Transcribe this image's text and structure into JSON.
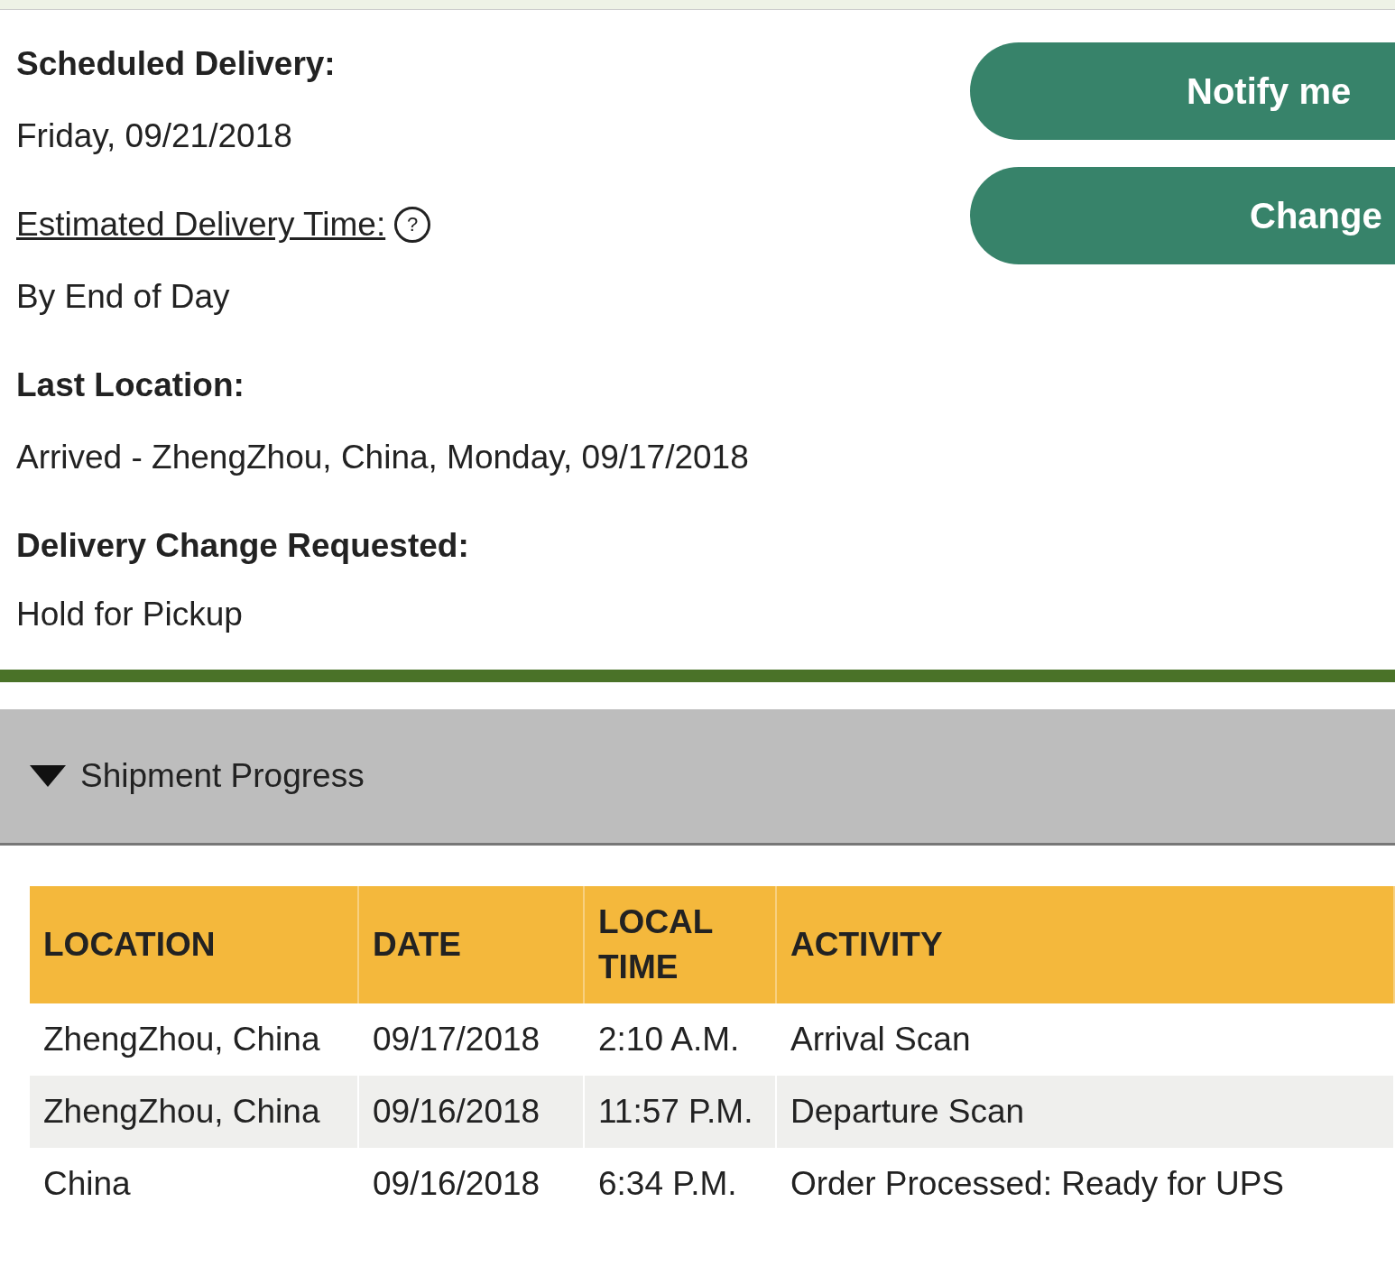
{
  "details": [
    {
      "label": "Scheduled Delivery:",
      "kind": "heading",
      "value": "Friday, 09/21/2018"
    },
    {
      "label": "Estimated Delivery Time:",
      "kind": "link",
      "value": "By End of Day",
      "help": "?"
    },
    {
      "label": "Last Location:",
      "kind": "heading",
      "value": "Arrived - ZhengZhou, China, Monday, 09/17/2018"
    },
    {
      "label": "Delivery Change Requested:",
      "kind": "heading",
      "value": "Hold for Pickup"
    }
  ],
  "buttons": [
    {
      "label": "Notify me"
    },
    {
      "label": "Change"
    }
  ],
  "progress": {
    "title": "Shipment Progress",
    "expanded": true
  },
  "table": {
    "columns": [
      "LOCATION",
      "DATE",
      "LOCAL TIME",
      "ACTIVITY"
    ],
    "rows": [
      [
        "ZhengZhou,  China",
        "09/17/2018",
        "2:10 A.M.",
        "Arrival Scan"
      ],
      [
        "ZhengZhou,  China",
        "09/16/2018",
        "11:57 P.M.",
        "Departure Scan"
      ],
      [
        "China",
        "09/16/2018",
        "6:34 P.M.",
        "Order Processed: Ready for UPS"
      ]
    ]
  }
}
